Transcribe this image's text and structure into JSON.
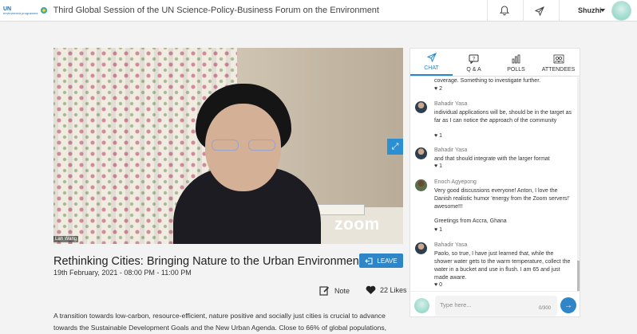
{
  "topbar": {
    "logo_un": "UN",
    "logo_sub": "environment programme",
    "event_title": "Third Global Session of the UN Science-Policy-Business Forum on the Environment",
    "user_name": "Shuzhi"
  },
  "video": {
    "watermark": "zoom",
    "speaker_name": "Lan Wang"
  },
  "session": {
    "title": "Rethinking Cities: Bringing Nature to the Urban Environment",
    "date": "19th February, 2021 - 08:00 PM - 11:00 PM",
    "leave_label": "LEAVE",
    "note_label": "Note",
    "likes_label": "22 Likes",
    "description": "A transition towards low-carbon, resource-efficient, nature positive and socially just cities is crucial to advance towards the Sustainable Development Goals and the New Urban Agenda. Close to 66% of global populations,"
  },
  "chat": {
    "tabs": [
      {
        "label": "CHAT",
        "icon": "send-icon",
        "active": true
      },
      {
        "label": "Q & A",
        "icon": "question-icon",
        "active": false
      },
      {
        "label": "POLLS",
        "icon": "bar-chart-icon",
        "active": false
      },
      {
        "label": "ATTENDEES",
        "icon": "attendees-icon",
        "active": false
      }
    ],
    "messages": [
      {
        "author": "",
        "text": "coverage.  Something to investigate further.",
        "likes": "2"
      },
      {
        "author": "Bahadir Yasa",
        "text": "individual applications will be, should be in the target as far as I can notice the approach of the community",
        "likes": "1"
      },
      {
        "author": "Bahadir Yasa",
        "text": "and that should integrate with the larger format",
        "likes": "1"
      },
      {
        "author": "Enoch Agyepong",
        "text": "Very good discussions everyone! Anton, I love the Danish realistic humor 'energy from the Zoom servers!' awesome!!!",
        "text2": "Greetings from Accra, Ghana",
        "likes": "1"
      },
      {
        "author": "Bahadir Yasa",
        "text": "Paolo, so true, I have just learned that, while the shower water gets to the warm temperature, collect the water in a bucket and use in flush. I am 65 and just made aware.",
        "likes": "0"
      }
    ],
    "input_placeholder": "Type here...",
    "char_count": "0/300"
  },
  "colors": {
    "accent": "#2e86c8"
  }
}
